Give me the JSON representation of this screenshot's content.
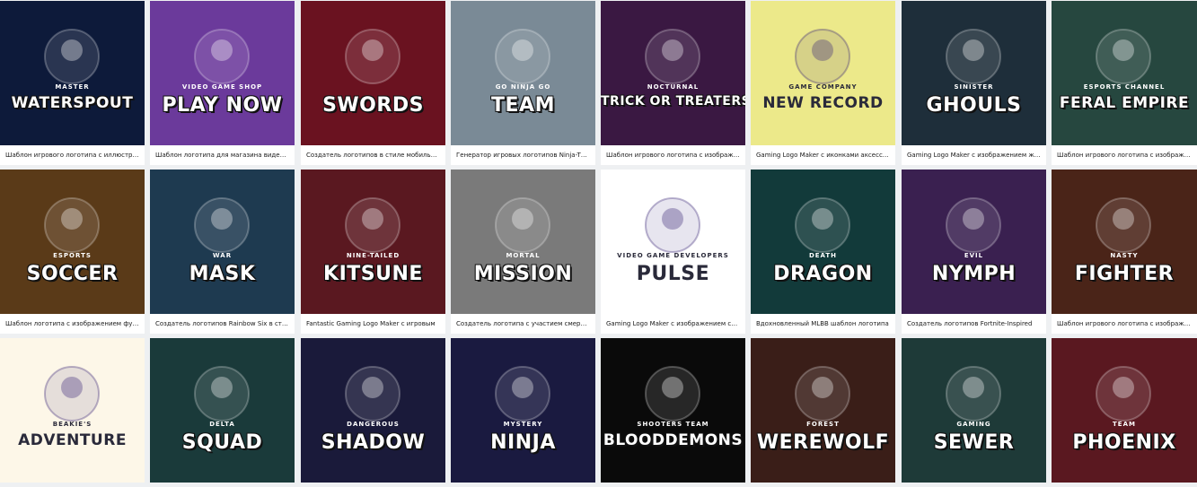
{
  "cards": [
    {
      "title": "Шаблон игрового логотипа с иллюстрацией",
      "bg": "#0d1a3a",
      "main": "WATERSPOUT",
      "sub": "MASTER"
    },
    {
      "title": "Шаблон логотипа для магазина видеоигр",
      "bg": "#6b3a9b",
      "main": "PLAY NOW",
      "sub": "VIDEO GAME SHOP"
    },
    {
      "title": "Создатель логотипов в стиле мобильных игр",
      "bg": "#6a1220",
      "main": "SWORDS",
      "sub": ""
    },
    {
      "title": "Генератор игровых логотипов Ninja-Themed",
      "bg": "#7a8a96",
      "main": "TEAM",
      "sub": "GO NINJA GO"
    },
    {
      "title": "Шаблон игрового логотипа с изображением",
      "bg": "#3a1842",
      "main": "TRICK OR TREATERS",
      "sub": "NOCTURNAL"
    },
    {
      "title": "Gaming Logo Maker с иконками аксессуаров",
      "bg": "#ece98a",
      "main": "NEW RECORD",
      "sub": "GAME COMPANY"
    },
    {
      "title": "Gaming Logo Maker с изображением жуткого",
      "bg": "#1e2e3a",
      "main": "GHOULS",
      "sub": "SINISTER"
    },
    {
      "title": "Шаблон игрового логотипа с изображением",
      "bg": "#26473f",
      "main": "FERAL EMPIRE",
      "sub": "ESPORTS CHANNEL"
    },
    {
      "title": "Шаблон логотипа с изображением футбола",
      "bg": "#5a3a18",
      "main": "SOCCER",
      "sub": "ESPORTS"
    },
    {
      "title": "Создатель логотипов Rainbow Six в стиле",
      "bg": "#1e3a50",
      "main": "MASK",
      "sub": "WAR"
    },
    {
      "title": "Fantastic Gaming Logo Maker с игровым",
      "bg": "#5a1820",
      "main": "KITSUNE",
      "sub": "NINE-TAILED"
    },
    {
      "title": "Создатель логотипа с участием смертных",
      "bg": "#7a7a7a",
      "main": "MISSION",
      "sub": "MORTAL"
    },
    {
      "title": "Gaming Logo Maker с изображением сердца",
      "bg": "#ffffff",
      "main": "PULSE",
      "sub": "VIDEO GAME DEVELOPERS"
    },
    {
      "title": "Вдохновленный MLBB шаблон логотипа",
      "bg": "#123a3a",
      "main": "DRAGON",
      "sub": "DEATH"
    },
    {
      "title": "Создатель логотипов Fortnite-Inspired",
      "bg": "#3a2050",
      "main": "NYMPH",
      "sub": "EVIL"
    },
    {
      "title": "Шаблон игрового логотипа с изображением бойца",
      "bg": "#4a2418",
      "main": "FIGHTER",
      "sub": "NASTY"
    },
    {
      "title": "",
      "bg": "#fdf7e8",
      "main": "ADVENTURE",
      "sub": "BEAKIE'S"
    },
    {
      "title": "",
      "bg": "#1a3a3a",
      "main": "SQUAD",
      "sub": "DELTA"
    },
    {
      "title": "",
      "bg": "#1a1a3a",
      "main": "SHADOW",
      "sub": "DANGEROUS"
    },
    {
      "title": "",
      "bg": "#1a1a40",
      "main": "NINJA",
      "sub": "MYSTERY"
    },
    {
      "title": "",
      "bg": "#0a0a0a",
      "main": "BLOODDEMONS",
      "sub": "SHOOTERS TEAM"
    },
    {
      "title": "",
      "bg": "#3a1e18",
      "main": "WEREWOLF",
      "sub": "FOREST"
    },
    {
      "title": "",
      "bg": "#1e3a38",
      "main": "SEWER",
      "sub": "GAMING"
    },
    {
      "title": "",
      "bg": "#5a1820",
      "main": "PHOENIX",
      "sub": "TEAM"
    }
  ]
}
